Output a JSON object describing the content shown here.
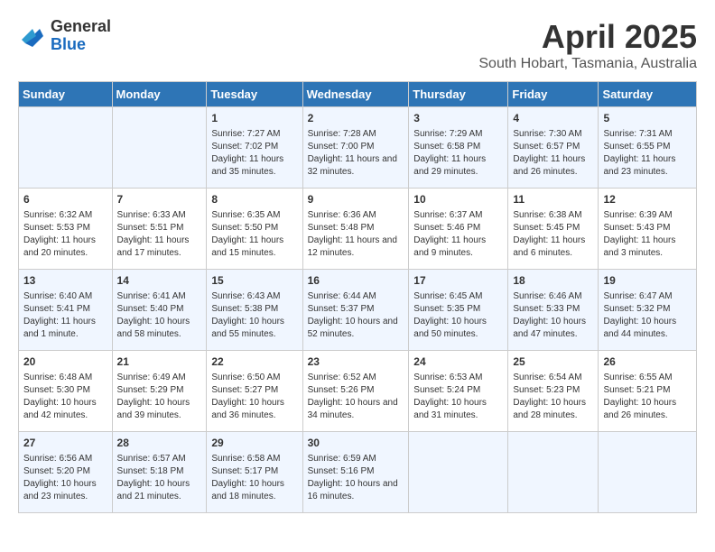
{
  "header": {
    "logo_general": "General",
    "logo_blue": "Blue",
    "main_title": "April 2025",
    "subtitle": "South Hobart, Tasmania, Australia"
  },
  "calendar": {
    "days_of_week": [
      "Sunday",
      "Monday",
      "Tuesday",
      "Wednesday",
      "Thursday",
      "Friday",
      "Saturday"
    ],
    "weeks": [
      [
        {
          "day": "",
          "sunrise": "",
          "sunset": "",
          "daylight": ""
        },
        {
          "day": "",
          "sunrise": "",
          "sunset": "",
          "daylight": ""
        },
        {
          "day": "1",
          "sunrise": "Sunrise: 7:27 AM",
          "sunset": "Sunset: 7:02 PM",
          "daylight": "Daylight: 11 hours and 35 minutes."
        },
        {
          "day": "2",
          "sunrise": "Sunrise: 7:28 AM",
          "sunset": "Sunset: 7:00 PM",
          "daylight": "Daylight: 11 hours and 32 minutes."
        },
        {
          "day": "3",
          "sunrise": "Sunrise: 7:29 AM",
          "sunset": "Sunset: 6:58 PM",
          "daylight": "Daylight: 11 hours and 29 minutes."
        },
        {
          "day": "4",
          "sunrise": "Sunrise: 7:30 AM",
          "sunset": "Sunset: 6:57 PM",
          "daylight": "Daylight: 11 hours and 26 minutes."
        },
        {
          "day": "5",
          "sunrise": "Sunrise: 7:31 AM",
          "sunset": "Sunset: 6:55 PM",
          "daylight": "Daylight: 11 hours and 23 minutes."
        }
      ],
      [
        {
          "day": "6",
          "sunrise": "Sunrise: 6:32 AM",
          "sunset": "Sunset: 5:53 PM",
          "daylight": "Daylight: 11 hours and 20 minutes."
        },
        {
          "day": "7",
          "sunrise": "Sunrise: 6:33 AM",
          "sunset": "Sunset: 5:51 PM",
          "daylight": "Daylight: 11 hours and 17 minutes."
        },
        {
          "day": "8",
          "sunrise": "Sunrise: 6:35 AM",
          "sunset": "Sunset: 5:50 PM",
          "daylight": "Daylight: 11 hours and 15 minutes."
        },
        {
          "day": "9",
          "sunrise": "Sunrise: 6:36 AM",
          "sunset": "Sunset: 5:48 PM",
          "daylight": "Daylight: 11 hours and 12 minutes."
        },
        {
          "day": "10",
          "sunrise": "Sunrise: 6:37 AM",
          "sunset": "Sunset: 5:46 PM",
          "daylight": "Daylight: 11 hours and 9 minutes."
        },
        {
          "day": "11",
          "sunrise": "Sunrise: 6:38 AM",
          "sunset": "Sunset: 5:45 PM",
          "daylight": "Daylight: 11 hours and 6 minutes."
        },
        {
          "day": "12",
          "sunrise": "Sunrise: 6:39 AM",
          "sunset": "Sunset: 5:43 PM",
          "daylight": "Daylight: 11 hours and 3 minutes."
        }
      ],
      [
        {
          "day": "13",
          "sunrise": "Sunrise: 6:40 AM",
          "sunset": "Sunset: 5:41 PM",
          "daylight": "Daylight: 11 hours and 1 minute."
        },
        {
          "day": "14",
          "sunrise": "Sunrise: 6:41 AM",
          "sunset": "Sunset: 5:40 PM",
          "daylight": "Daylight: 10 hours and 58 minutes."
        },
        {
          "day": "15",
          "sunrise": "Sunrise: 6:43 AM",
          "sunset": "Sunset: 5:38 PM",
          "daylight": "Daylight: 10 hours and 55 minutes."
        },
        {
          "day": "16",
          "sunrise": "Sunrise: 6:44 AM",
          "sunset": "Sunset: 5:37 PM",
          "daylight": "Daylight: 10 hours and 52 minutes."
        },
        {
          "day": "17",
          "sunrise": "Sunrise: 6:45 AM",
          "sunset": "Sunset: 5:35 PM",
          "daylight": "Daylight: 10 hours and 50 minutes."
        },
        {
          "day": "18",
          "sunrise": "Sunrise: 6:46 AM",
          "sunset": "Sunset: 5:33 PM",
          "daylight": "Daylight: 10 hours and 47 minutes."
        },
        {
          "day": "19",
          "sunrise": "Sunrise: 6:47 AM",
          "sunset": "Sunset: 5:32 PM",
          "daylight": "Daylight: 10 hours and 44 minutes."
        }
      ],
      [
        {
          "day": "20",
          "sunrise": "Sunrise: 6:48 AM",
          "sunset": "Sunset: 5:30 PM",
          "daylight": "Daylight: 10 hours and 42 minutes."
        },
        {
          "day": "21",
          "sunrise": "Sunrise: 6:49 AM",
          "sunset": "Sunset: 5:29 PM",
          "daylight": "Daylight: 10 hours and 39 minutes."
        },
        {
          "day": "22",
          "sunrise": "Sunrise: 6:50 AM",
          "sunset": "Sunset: 5:27 PM",
          "daylight": "Daylight: 10 hours and 36 minutes."
        },
        {
          "day": "23",
          "sunrise": "Sunrise: 6:52 AM",
          "sunset": "Sunset: 5:26 PM",
          "daylight": "Daylight: 10 hours and 34 minutes."
        },
        {
          "day": "24",
          "sunrise": "Sunrise: 6:53 AM",
          "sunset": "Sunset: 5:24 PM",
          "daylight": "Daylight: 10 hours and 31 minutes."
        },
        {
          "day": "25",
          "sunrise": "Sunrise: 6:54 AM",
          "sunset": "Sunset: 5:23 PM",
          "daylight": "Daylight: 10 hours and 28 minutes."
        },
        {
          "day": "26",
          "sunrise": "Sunrise: 6:55 AM",
          "sunset": "Sunset: 5:21 PM",
          "daylight": "Daylight: 10 hours and 26 minutes."
        }
      ],
      [
        {
          "day": "27",
          "sunrise": "Sunrise: 6:56 AM",
          "sunset": "Sunset: 5:20 PM",
          "daylight": "Daylight: 10 hours and 23 minutes."
        },
        {
          "day": "28",
          "sunrise": "Sunrise: 6:57 AM",
          "sunset": "Sunset: 5:18 PM",
          "daylight": "Daylight: 10 hours and 21 minutes."
        },
        {
          "day": "29",
          "sunrise": "Sunrise: 6:58 AM",
          "sunset": "Sunset: 5:17 PM",
          "daylight": "Daylight: 10 hours and 18 minutes."
        },
        {
          "day": "30",
          "sunrise": "Sunrise: 6:59 AM",
          "sunset": "Sunset: 5:16 PM",
          "daylight": "Daylight: 10 hours and 16 minutes."
        },
        {
          "day": "",
          "sunrise": "",
          "sunset": "",
          "daylight": ""
        },
        {
          "day": "",
          "sunrise": "",
          "sunset": "",
          "daylight": ""
        },
        {
          "day": "",
          "sunrise": "",
          "sunset": "",
          "daylight": ""
        }
      ]
    ]
  }
}
